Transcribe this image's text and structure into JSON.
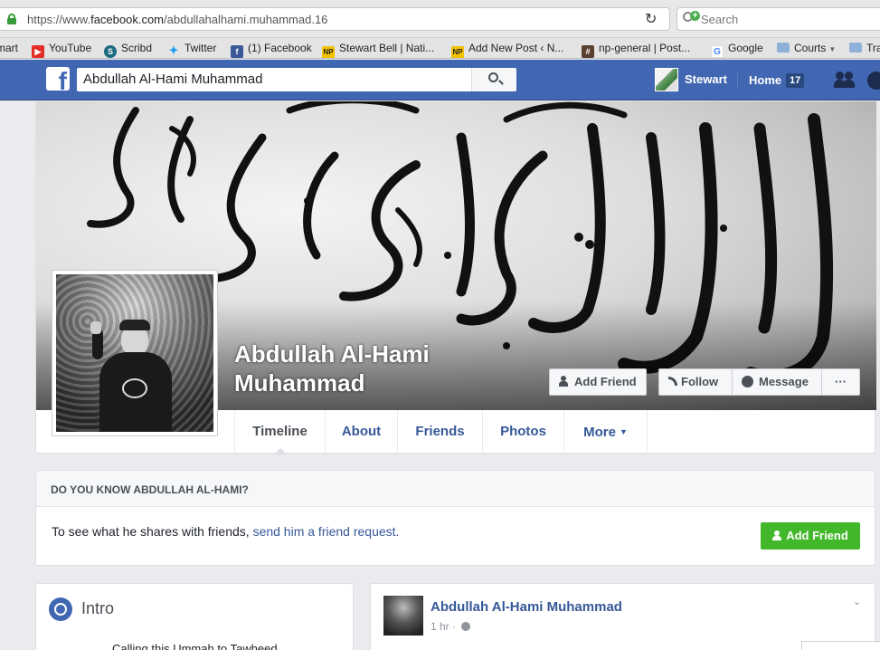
{
  "browser": {
    "url_prefix": "https://www.",
    "url_host": "facebook.com",
    "url_path": "/abdullahalhami.muhammad.16",
    "search_placeholder": "Search"
  },
  "bookmarks": [
    {
      "label": "mart",
      "icon": "none"
    },
    {
      "label": "YouTube",
      "icon": "youtube-icon"
    },
    {
      "label": "Scribd",
      "icon": "scribd-icon"
    },
    {
      "label": "Twitter",
      "icon": "twitter-icon"
    },
    {
      "label": "(1) Facebook",
      "icon": "facebook-icon"
    },
    {
      "label": "Stewart Bell | Nati...",
      "icon": "national-post-icon"
    },
    {
      "label": "Add New Post ‹ N...",
      "icon": "national-post-icon"
    },
    {
      "label": "np-general | Post...",
      "icon": "hash-icon"
    },
    {
      "label": "Google",
      "icon": "google-icon"
    },
    {
      "label": "Courts",
      "icon": "folder-icon"
    },
    {
      "label": "Tra",
      "icon": "folder-icon"
    }
  ],
  "fb_nav": {
    "search_value": "Abdullah Al-Hami Muhammad",
    "user_name": "Stewart",
    "home_label": "Home",
    "home_count": "17"
  },
  "profile": {
    "name_line1": "Abdullah Al-Hami",
    "name_line2": "Muhammad",
    "add_friend": "Add Friend",
    "follow": "Follow",
    "message": "Message",
    "more_dots": "···",
    "tabs": [
      "Timeline",
      "About",
      "Friends",
      "Photos",
      "More"
    ]
  },
  "know": {
    "heading": "DO YOU KNOW ABDULLAH AL-HAMI?",
    "text": "To see what he shares with friends, ",
    "link": "send him a friend request.",
    "button": "Add Friend"
  },
  "intro": {
    "title": "Intro",
    "bio": "Calling this Ummah to Tawheed"
  },
  "post": {
    "author": "Abdullah Al-Hami Muhammad",
    "time": "1 hr · "
  },
  "colors": {
    "fb_blue": "#4267b2",
    "link_blue": "#365899",
    "green": "#42b72a"
  }
}
